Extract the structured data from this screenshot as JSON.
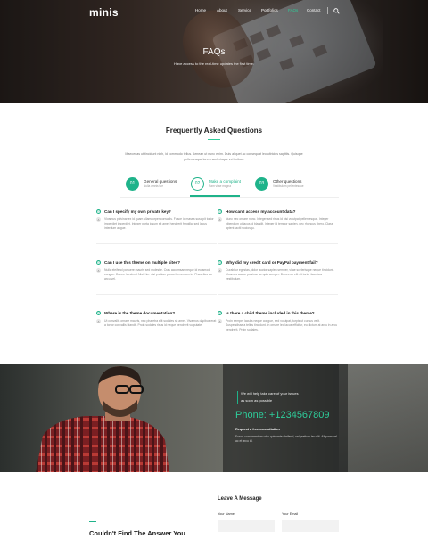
{
  "header": {
    "logo": "minis",
    "nav": [
      "Home",
      "About",
      "Service",
      "Portfolios",
      "FAQs",
      "Contact"
    ],
    "active_nav": "FAQs",
    "accent": "#2ecc9a"
  },
  "hero": {
    "title": "FAQs",
    "subtitle": "Have access to the real-time updates the first time."
  },
  "faq": {
    "title": "Frequently Asked Questions",
    "description": "Maecenas ut tincidunt nibh, id commodo tellus. Aenean ut nunc enim. Duis aliquet ac consequat leo ultricies sagittis. Quisque pellentesque lorem scelerisque vel finibus.",
    "tabs": [
      {
        "num": "01",
        "title": "General questions",
        "sub": "Nulla omnis tue"
      },
      {
        "num": "02",
        "title": "Make a complaint",
        "sub": "Nam vitae magna"
      },
      {
        "num": "03",
        "title": "Other questions",
        "sub": "Vestibulum pellentesque"
      }
    ],
    "q_icon": "Q",
    "a_icon": "A",
    "items": [
      {
        "q": "Can I specify my own private key?",
        "a": "Vivamus pulvinar ex id quam ullamcorper convallis. Fusce id massa suscipit tortor imperdiet imperdiet. Integer porta ipsum sit amet hendrerit fringilla, sed lacus interdum augue."
      },
      {
        "q": "How can I access my account data?",
        "a": "Nunc nec ornare nunc. Integer sed risus id nisi volutpat pellentesque. Integer bibendum ut lacus id blandit. Integer id tempor sapien, nec rhoncus libero. Class aptent taciti sociosqu."
      },
      {
        "q": "Can I use this theme on multiple sites?",
        "a": "Nulla eleifend posuere mauris sed molestie. Cras accumsan neque id euismod congue. Donec hendrerit Nisi. hic. nisi pretium purus fermentum in. Phasellus eu arcu vel."
      },
      {
        "q": "Why did my credit card or PayPal payment fail?",
        "a": "Curabitur egestas, dolor auctor sapien semper, vitae scelerisque neque tincidunt. Vivamus auctor pulvinar ac quis semper. Donec ac elit sit tortor faucibus vestibulum."
      },
      {
        "q": "Where is the theme documentation?",
        "a": "Ut convallis ornare mauris, nec pharetra elit sodales sit amet. Vivamus dapibus erat a tortor convallis blandit. Proin sodales risus id neque hendrerit vulputate."
      },
      {
        "q": "Is there a child theme included in this theme?",
        "a": "Proin semper iaculis neque congue, sed volutpat, turpis ut cursus velit. Suspendisse a tellus tincidunt. In ornare leo lacus efficitur, eu dictum at arcu in arcu hendrerit. Proin sodales."
      }
    ]
  },
  "cta": {
    "line1": "We will help take care of your issues",
    "line2": "as soon as possible",
    "phone": "Phone: +1234567809",
    "request": "Request a free consultation",
    "desc": "Fusce condimentum odio quis ante eleifend, vel pretium leo elit. Aliquam vel ac et arcu id."
  },
  "contact": {
    "message_title": "Leave A Message",
    "name_label": "Your Name",
    "email_label": "Your Email",
    "cant_find": "Couldn't Find The Answer You"
  }
}
